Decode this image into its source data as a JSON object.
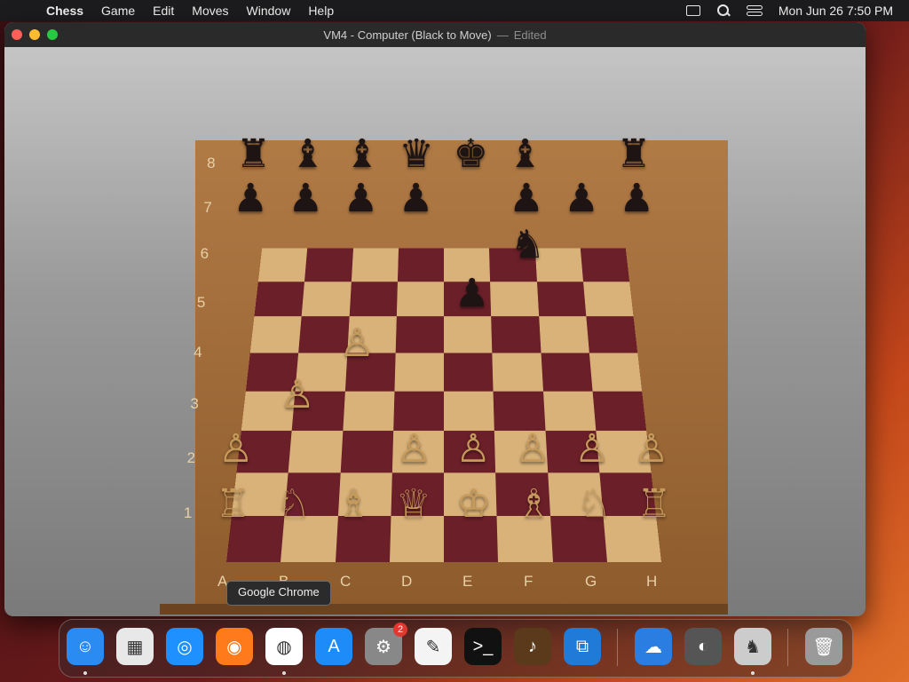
{
  "menubar": {
    "apple": "",
    "app_name": "Chess",
    "items": [
      "Game",
      "Edit",
      "Moves",
      "Window",
      "Help"
    ],
    "datetime": "Mon Jun 26  7:50 PM"
  },
  "window": {
    "title": "VM4 - Computer   (Black to Move)",
    "separator": "—",
    "status": "Edited"
  },
  "board": {
    "ranks": [
      "8",
      "7",
      "6",
      "5",
      "4",
      "3",
      "2",
      "1"
    ],
    "files": [
      "A",
      "B",
      "C",
      "D",
      "E",
      "F",
      "G",
      "H"
    ],
    "pieces": [
      {
        "sq": "a8",
        "glyph": "♜",
        "color": "black"
      },
      {
        "sq": "b8",
        "glyph": "♝",
        "color": "black"
      },
      {
        "sq": "c8",
        "glyph": "♝",
        "color": "black"
      },
      {
        "sq": "d8",
        "glyph": "♛",
        "color": "black"
      },
      {
        "sq": "e8",
        "glyph": "♚",
        "color": "black"
      },
      {
        "sq": "f8",
        "glyph": "♝",
        "color": "black"
      },
      {
        "sq": "h8",
        "glyph": "♜",
        "color": "black"
      },
      {
        "sq": "a7",
        "glyph": "♟",
        "color": "black"
      },
      {
        "sq": "b7",
        "glyph": "♟",
        "color": "black"
      },
      {
        "sq": "c7",
        "glyph": "♟",
        "color": "black"
      },
      {
        "sq": "d7",
        "glyph": "♟",
        "color": "black"
      },
      {
        "sq": "f7",
        "glyph": "♟",
        "color": "black"
      },
      {
        "sq": "g7",
        "glyph": "♟",
        "color": "black"
      },
      {
        "sq": "h7",
        "glyph": "♟",
        "color": "black"
      },
      {
        "sq": "f6",
        "glyph": "♞",
        "color": "black"
      },
      {
        "sq": "e5",
        "glyph": "♟",
        "color": "black"
      },
      {
        "sq": "c4",
        "glyph": "♙",
        "color": "white"
      },
      {
        "sq": "b3",
        "glyph": "♙",
        "color": "white"
      },
      {
        "sq": "a2",
        "glyph": "♙",
        "color": "white"
      },
      {
        "sq": "d2",
        "glyph": "♙",
        "color": "white"
      },
      {
        "sq": "e2",
        "glyph": "♙",
        "color": "white"
      },
      {
        "sq": "f2",
        "glyph": "♙",
        "color": "white"
      },
      {
        "sq": "g2",
        "glyph": "♙",
        "color": "white"
      },
      {
        "sq": "h2",
        "glyph": "♙",
        "color": "white"
      },
      {
        "sq": "a1",
        "glyph": "♖",
        "color": "white"
      },
      {
        "sq": "b1",
        "glyph": "♘",
        "color": "white"
      },
      {
        "sq": "c1",
        "glyph": "♗",
        "color": "white"
      },
      {
        "sq": "d1",
        "glyph": "♕",
        "color": "white"
      },
      {
        "sq": "e1",
        "glyph": "♔",
        "color": "white"
      },
      {
        "sq": "f1",
        "glyph": "♗",
        "color": "white"
      },
      {
        "sq": "g1",
        "glyph": "♘",
        "color": "white"
      },
      {
        "sq": "h1",
        "glyph": "♖",
        "color": "white"
      }
    ]
  },
  "tooltip": {
    "text": "Google Chrome"
  },
  "dock": {
    "apps": [
      {
        "name": "finder-icon",
        "glyph": "☺",
        "color": "#2a8bf2"
      },
      {
        "name": "launchpad-icon",
        "glyph": "▦",
        "color": "#e8e8e8"
      },
      {
        "name": "safari-icon",
        "glyph": "◎",
        "color": "#1e90ff"
      },
      {
        "name": "firefox-icon",
        "glyph": "◉",
        "color": "#ff7a1a"
      },
      {
        "name": "chrome-icon",
        "glyph": "◍",
        "color": "#ffffff"
      },
      {
        "name": "app-store-icon",
        "glyph": "A",
        "color": "#1d8cf8"
      },
      {
        "name": "system-settings-icon",
        "glyph": "⚙",
        "color": "#888888",
        "badge": "2"
      },
      {
        "name": "textedit-icon",
        "glyph": "✎",
        "color": "#f4f4f4"
      },
      {
        "name": "terminal-icon",
        "glyph": ">_",
        "color": "#111111"
      },
      {
        "name": "garageband-icon",
        "glyph": "♪",
        "color": "#5a3a1a"
      },
      {
        "name": "vscode-icon",
        "glyph": "⧉",
        "color": "#1f7ad8"
      },
      {
        "name": "weather-icon",
        "glyph": "☁",
        "color": "#2a7de1"
      },
      {
        "name": "photo-booth-icon",
        "glyph": "◐",
        "color": "#555555"
      },
      {
        "name": "chess-icon",
        "glyph": "♞",
        "color": "#cccccc"
      },
      {
        "name": "trash-icon",
        "glyph": "🗑",
        "color": "#9a9a9a"
      }
    ]
  }
}
